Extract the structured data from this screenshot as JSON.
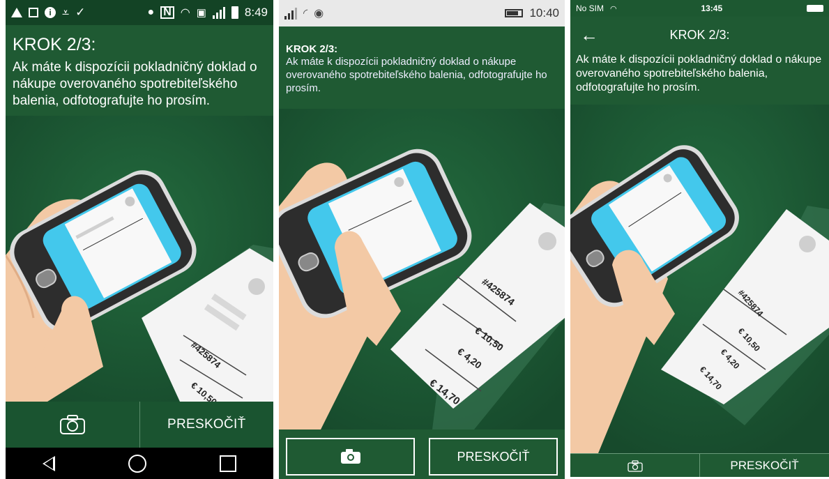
{
  "panels": [
    {
      "status": {
        "time": "8:49"
      },
      "step_title": "KROK 2/3:",
      "description": "Ak máte k dispozícii pokladničný doklad o nákupe overovaného spotrebiteľského balenia, odfotografujte ho prosím.",
      "skip_label": "PRESKOČIŤ"
    },
    {
      "status": {
        "time": "10:40"
      },
      "step_title": "KROK 2/3:",
      "description": "Ak máte k dispozícii pokladničný doklad o nákupe overovaného spotrebiteľského balenia, odfotografujte ho prosím.",
      "skip_label": "PRESKOČIŤ"
    },
    {
      "status": {
        "carrier": "No SIM",
        "time": "13:45"
      },
      "step_title": "KROK 2/3:",
      "description": "Ak máte k dispozícii pokladničný doklad o nákupe overovaného spotrebiteľského balenia, odfotografujte ho prosím.",
      "skip_label": "PRESKOČIŤ"
    }
  ],
  "receipt": {
    "number": "#425874",
    "price1": "€ 10,50",
    "price2": "€ 4,20",
    "total": "€ 14,70"
  },
  "icons": [
    "camera-icon",
    "back-arrow-icon",
    "wifi-icon",
    "battery-icon",
    "signal-icon"
  ],
  "colors": {
    "brand_green": "#1f5a33",
    "dark_green": "#134325",
    "screen_cyan": "#43c8ec",
    "skin": "#f3c9a5"
  }
}
